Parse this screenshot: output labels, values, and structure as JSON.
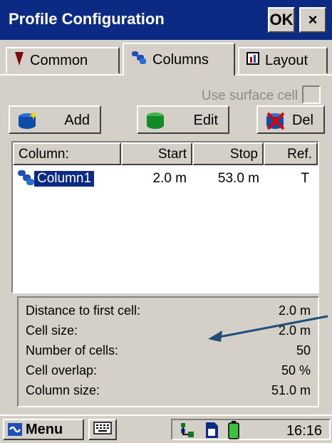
{
  "window": {
    "title": "Profile Configuration",
    "ok_label": "OK",
    "close_label": "×"
  },
  "tabs": [
    {
      "label": "Common",
      "icon": "pin-icon"
    },
    {
      "label": "Columns",
      "icon": "columns-icon",
      "active": true
    },
    {
      "label": "Layout",
      "icon": "layout-icon"
    }
  ],
  "options": {
    "use_surface_cell_label": "Use surface cell",
    "use_surface_cell_checked": false,
    "use_surface_cell_enabled": false
  },
  "toolbar": {
    "add_label": "Add",
    "edit_label": "Edit",
    "del_label": "Del"
  },
  "columns_table": {
    "headers": [
      "Column:",
      "Start",
      "Stop",
      "Ref."
    ],
    "rows": [
      {
        "name": "Column1",
        "start": "2.0 m",
        "stop": "53.0 m",
        "ref": "T",
        "selected": true
      }
    ]
  },
  "info": [
    {
      "label": "Distance to first cell:",
      "value": "2.0 m"
    },
    {
      "label": "Cell size:",
      "value": "2.0 m"
    },
    {
      "label": "Number of cells:",
      "value": "50"
    },
    {
      "label": "Cell overlap:",
      "value": "50 %"
    },
    {
      "label": "Column size:",
      "value": "51.0 m"
    }
  ],
  "taskbar": {
    "menu_label": "Menu",
    "clock": "16:16"
  },
  "colors": {
    "title_bar": "#0a2a84",
    "face": "#d4d0c8",
    "selection": "#0a2a84",
    "annotation_arrow": "#1f4e79"
  }
}
